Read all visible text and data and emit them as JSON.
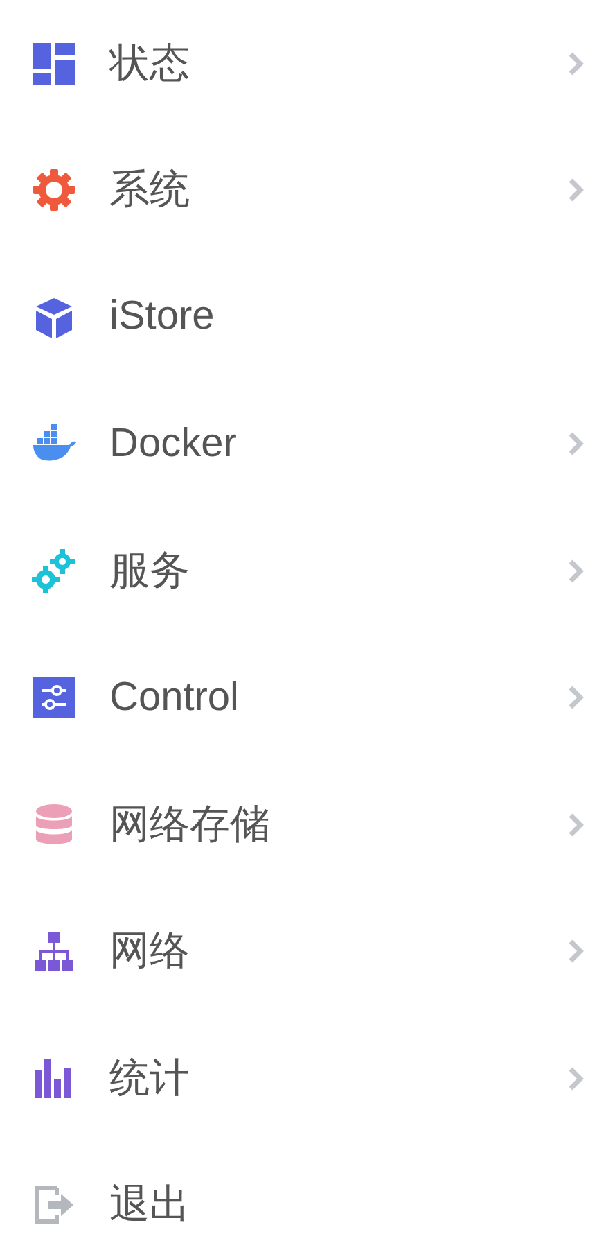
{
  "menu": [
    {
      "label": "状态",
      "has_submenu": true
    },
    {
      "label": "系统",
      "has_submenu": true
    },
    {
      "label": "iStore",
      "has_submenu": false
    },
    {
      "label": "Docker",
      "has_submenu": true
    },
    {
      "label": "服务",
      "has_submenu": true
    },
    {
      "label": "Control",
      "has_submenu": true
    },
    {
      "label": "网络存储",
      "has_submenu": true
    },
    {
      "label": "网络",
      "has_submenu": true
    },
    {
      "label": "统计",
      "has_submenu": true
    },
    {
      "label": "退出",
      "has_submenu": false
    }
  ]
}
